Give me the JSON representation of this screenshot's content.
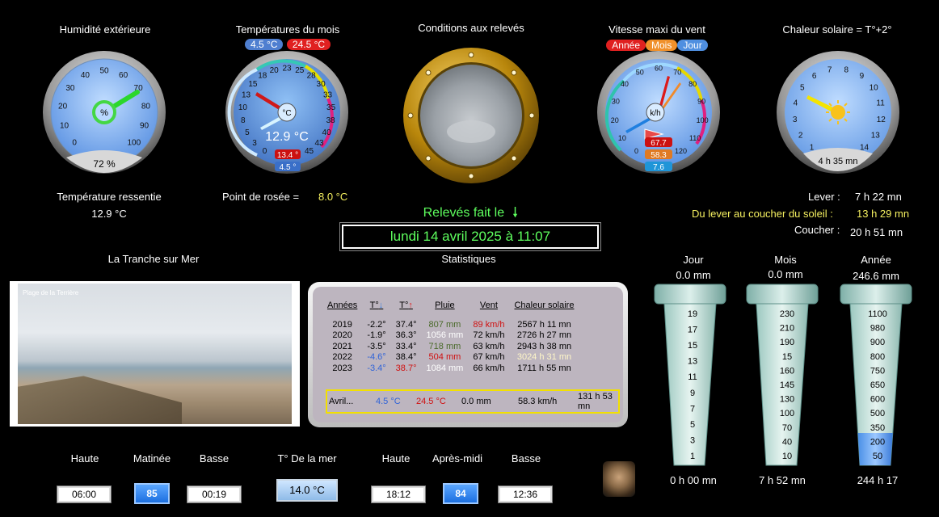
{
  "humidity": {
    "title": "Humidité extérieure",
    "unit": "%",
    "value_text": "72 %",
    "value": 72,
    "ticks": [
      "0",
      "10",
      "20",
      "30",
      "40",
      "50",
      "60",
      "70",
      "80",
      "90",
      "100"
    ]
  },
  "month_temp": {
    "title": "Températures du mois",
    "min_badge": "4.5 °C",
    "max_badge": "24.5 °C",
    "unit": "°C",
    "current": "12.9 °C",
    "current_value": 12.9,
    "badge_high": "13.4 °",
    "badge_low": "4.5 °",
    "ticks": [
      "0",
      "3",
      "5",
      "8",
      "10",
      "13",
      "15",
      "18",
      "20",
      "23",
      "25",
      "28",
      "30",
      "33",
      "35",
      "38",
      "40",
      "43",
      "45"
    ]
  },
  "conditions": {
    "title": "Conditions aux relevés"
  },
  "wind": {
    "title": "Vitesse maxi du vent",
    "tabs": [
      "Année",
      "Mois",
      "Jour"
    ],
    "unit": "k/h",
    "year": "67.7",
    "month": "58.3",
    "day": "7.6",
    "ticks": [
      "0",
      "10",
      "20",
      "30",
      "40",
      "50",
      "60",
      "70",
      "80",
      "90",
      "100",
      "110",
      "120"
    ]
  },
  "solar": {
    "title": "Chaleur solaire = T°+2°",
    "duration": "4 h 35 mn",
    "ticks": [
      "0",
      "1",
      "2",
      "3",
      "4",
      "5",
      "6",
      "7",
      "8",
      "9",
      "10",
      "11",
      "12",
      "13",
      "14",
      "15"
    ]
  },
  "feels_like": {
    "label": "Température ressentie",
    "value": "12.9 °C"
  },
  "dew_point": {
    "label": "Point de rosée  =",
    "value": "8.0 °C"
  },
  "reading": {
    "label": "Relevés fait le",
    "date": "lundi 14 avril 2025 à 11:07"
  },
  "sun": {
    "rise_label": "Lever :",
    "rise": "7 h 22 mn",
    "day_label": "Du lever au coucher du soleil :",
    "day": "13 h 29 mn",
    "set_label": "Coucher :",
    "set": "20 h 51 mn"
  },
  "webcam": {
    "title": "La Tranche sur Mer",
    "caption": "Plage de la Terrière"
  },
  "stats": {
    "title": "Statistiques",
    "headers": [
      "Années",
      "T°",
      "T°",
      "Pluie",
      "Vent",
      "Chaleur solaire"
    ],
    "rows": [
      [
        "2019",
        "-2.2°",
        "37.4°",
        "807 mm",
        "89 km/h",
        "2567 h 11 mn"
      ],
      [
        "2020",
        "-1.9°",
        "36.3°",
        "1056 mm",
        "72 km/h",
        "2726 h 27 mn"
      ],
      [
        "2021",
        "-3.5°",
        "33.4°",
        "718 mm",
        "63 km/h",
        "2943 h 38 mn"
      ],
      [
        "2022",
        "-4.6°",
        "38.4°",
        "504 mm",
        "67 km/h",
        "3024 h 31 mn"
      ],
      [
        "2023",
        "-3.4°",
        "38.7°",
        "1084 mm",
        "66 km/h",
        "1711 h 55 mn"
      ]
    ],
    "summary": [
      "Avril...",
      "4.5 °C",
      "24.5 °C",
      "0.0 mm",
      "58.3 km/h",
      "131 h 53 mn"
    ]
  },
  "rain": {
    "day": {
      "label": "Jour",
      "value": "0.0 mm",
      "duration": "0 h 00 mn",
      "scale": [
        "19",
        "17",
        "15",
        "13",
        "11",
        "9",
        "7",
        "5",
        "3",
        "1"
      ]
    },
    "month": {
      "label": "Mois",
      "value": "0.0 mm",
      "duration": "7 h 52 mn",
      "scale": [
        "230",
        "210",
        "190",
        "15",
        "160",
        "145",
        "130",
        "100",
        "70",
        "40",
        "10"
      ]
    },
    "year": {
      "label": "Année",
      "value": "246.6 mm",
      "duration": "244 h 17",
      "fill": 0.2,
      "scale": [
        "1100",
        "980",
        "900",
        "800",
        "750",
        "650",
        "600",
        "500",
        "350",
        "200",
        "50"
      ]
    }
  },
  "tide": {
    "morning": {
      "label": "Matinée",
      "high_label": "Haute",
      "low_label": "Basse",
      "high": "06:00",
      "coef": "85",
      "low": "00:19"
    },
    "sea": {
      "label": "T° De la mer",
      "value": "14.0 °C"
    },
    "afternoon": {
      "label": "Après-midi",
      "high_label": "Haute",
      "low_label": "Basse",
      "high": "18:12",
      "coef": "84",
      "low": "12:36"
    }
  }
}
